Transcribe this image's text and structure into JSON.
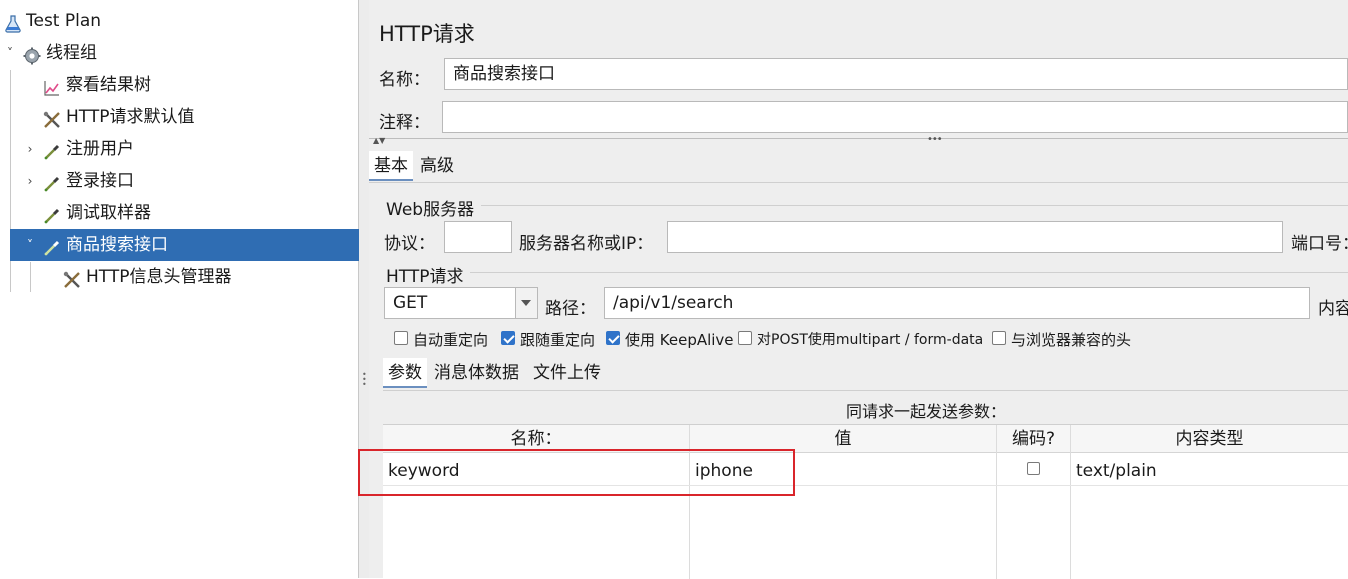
{
  "tree": {
    "items": [
      {
        "label": "Test Plan",
        "icon": "flask-icon"
      },
      {
        "label": "线程组",
        "icon": "gear-icon",
        "expander": "˅"
      },
      {
        "label": "察看结果树",
        "icon": "chart-icon"
      },
      {
        "label": "HTTP请求默认值",
        "icon": "tools-icon"
      },
      {
        "label": "注册用户",
        "icon": "pipette-icon",
        "expander": "›"
      },
      {
        "label": " 登录接口",
        "icon": "pipette-icon",
        "expander": "›"
      },
      {
        "label": "调试取样器",
        "icon": "pipette-icon"
      },
      {
        "label": " 商品搜索接口",
        "icon": "pipette-icon",
        "expander": "˅",
        "selected": true
      },
      {
        "label": "HTTP信息头管理器",
        "icon": "tools-icon"
      }
    ]
  },
  "panel": {
    "title": "HTTP请求",
    "name_label": "名称：",
    "name_value": "商品搜索接口",
    "comment_label": "注释：",
    "comment_value": "",
    "tabs": [
      "基本",
      "高级"
    ],
    "web_server": {
      "section_title": "Web服务器",
      "protocol_label": "协议：",
      "protocol_value": "",
      "server_label": "服务器名称或IP：",
      "server_value": "",
      "port_label": "端口号："
    },
    "http_request": {
      "section_title": "HTTP请求",
      "method": "GET",
      "path_label": "路径：",
      "path_value": "/api/v1/search",
      "content_label": "内容"
    },
    "options": [
      {
        "label": "自动重定向",
        "checked": false
      },
      {
        "label": "跟随重定向",
        "checked": true
      },
      {
        "label": "使用 KeepAlive",
        "checked": true
      },
      {
        "label": "对POST使用multipart / form-data",
        "checked": false
      },
      {
        "label": "与浏览器兼容的头",
        "checked": false
      }
    ],
    "sub_tabs": [
      "参数",
      "消息体数据",
      "文件上传"
    ],
    "params_caption": "同请求一起发送参数：",
    "table": {
      "headers": [
        "名称：",
        "值",
        "编码?",
        "内容类型"
      ],
      "rows": [
        {
          "name": "keyword",
          "value": "iphone",
          "encode": false,
          "content_type": "text/plain"
        }
      ]
    }
  },
  "colors": {
    "selection": "#2f6db3",
    "highlight": "#d9252b",
    "checkbox": "#2f73c9"
  }
}
